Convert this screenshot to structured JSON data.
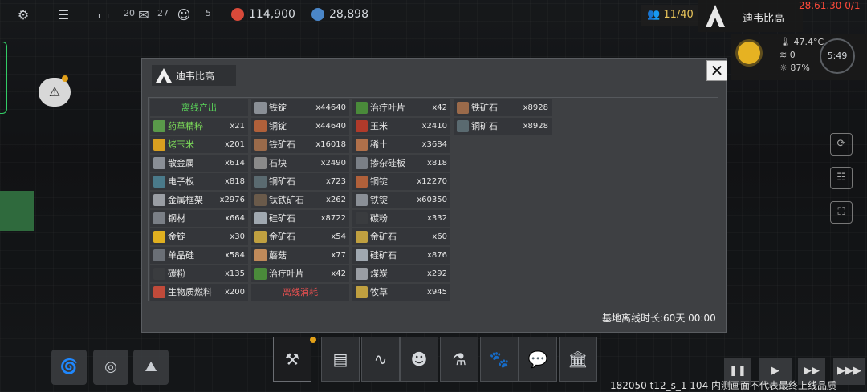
{
  "topbar": {
    "icons": [
      "gear-icon",
      "chat-icon",
      "message-icon",
      "mail-icon",
      "person-icon"
    ],
    "mail_count": "20",
    "person_count": "27",
    "small_text_left": "5",
    "resource1": {
      "value": "114,900",
      "color": "#d84a3a"
    },
    "resource2": {
      "value": "28,898",
      "color": "#4a86c8"
    }
  },
  "population": {
    "value": "11/40"
  },
  "base_name": "迪韦比高",
  "clock": "28.61.30 0/1",
  "weather": {
    "temperature": "47.4°C",
    "wind": "0",
    "light": "87%",
    "time": "5:49"
  },
  "modal": {
    "title": "迪韦比高",
    "close_label": "✕",
    "footer": "基地离线时长:60天 00:00",
    "columns": [
      [
        {
          "type": "header",
          "label": "离线产出",
          "tone": "green"
        },
        {
          "label": "药草精粹",
          "count": "x21",
          "icon": "herb-essence-icon",
          "color": "#5a9a4a",
          "highlight": true
        },
        {
          "label": "烤玉米",
          "count": "x201",
          "icon": "roasted-corn-icon",
          "color": "#d9a020",
          "highlight": true
        },
        {
          "label": "散金属",
          "count": "x614",
          "icon": "scrap-metal-icon",
          "color": "#8a8f96"
        },
        {
          "label": "电子板",
          "count": "x818",
          "icon": "circuit-board-icon",
          "color": "#4a7a8a"
        },
        {
          "label": "金属框架",
          "count": "x2976",
          "icon": "metal-frame-icon",
          "color": "#9a9ea4"
        },
        {
          "label": "钢材",
          "count": "x664",
          "icon": "steel-icon",
          "color": "#7a7f86"
        },
        {
          "label": "金锭",
          "count": "x30",
          "icon": "gold-ingot-icon",
          "color": "#e0b020"
        },
        {
          "label": "单晶硅",
          "count": "x584",
          "icon": "monocrystal-silicon-icon",
          "color": "#6a6f76"
        },
        {
          "label": "碳粉",
          "count": "x135",
          "icon": "carbon-powder-icon",
          "color": "#3a3c3f"
        },
        {
          "label": "生物质燃料",
          "count": "x200",
          "icon": "biomass-fuel-icon",
          "color": "#c04a3a"
        }
      ],
      [
        {
          "label": "铁锭",
          "count": "x44640",
          "icon": "iron-ingot-icon",
          "color": "#8a8f96"
        },
        {
          "label": "铜锭",
          "count": "x44640",
          "icon": "copper-ingot-icon",
          "color": "#b0603a"
        },
        {
          "label": "铁矿石",
          "count": "x16018",
          "icon": "iron-ore-icon",
          "color": "#9a6a4a"
        },
        {
          "label": "石块",
          "count": "x2490",
          "icon": "stone-icon",
          "color": "#8a8a8a"
        },
        {
          "label": "铜矿石",
          "count": "x723",
          "icon": "copper-ore-icon",
          "color": "#5a6a70"
        },
        {
          "label": "钛铁矿石",
          "count": "x262",
          "icon": "ilmenite-ore-icon",
          "color": "#6a5a4a"
        },
        {
          "label": "硅矿石",
          "count": "x8722",
          "icon": "silicon-ore-icon",
          "color": "#a0a8b0"
        },
        {
          "label": "金矿石",
          "count": "x54",
          "icon": "gold-ore-icon",
          "color": "#c0a040"
        },
        {
          "label": "蘑菇",
          "count": "x77",
          "icon": "mushroom-icon",
          "color": "#c08a5a"
        },
        {
          "label": "治疗叶片",
          "count": "x42",
          "icon": "healing-leaf-icon",
          "color": "#4a8a3a"
        },
        {
          "type": "header",
          "label": "离线消耗",
          "tone": "red"
        }
      ],
      [
        {
          "label": "治疗叶片",
          "count": "x42",
          "icon": "healing-leaf-icon",
          "color": "#4a8a3a"
        },
        {
          "label": "玉米",
          "count": "x2410",
          "icon": "corn-icon",
          "color": "#b03a2a"
        },
        {
          "label": "稀土",
          "count": "x3684",
          "icon": "rare-earth-icon",
          "color": "#b0704a"
        },
        {
          "label": "掺杂硅板",
          "count": "x818",
          "icon": "doped-silicon-icon",
          "color": "#7a7f86"
        },
        {
          "label": "铜锭",
          "count": "x12270",
          "icon": "copper-ingot-icon",
          "color": "#b0603a"
        },
        {
          "label": "铁锭",
          "count": "x60350",
          "icon": "iron-ingot-icon",
          "color": "#8a8f96"
        },
        {
          "label": "碳粉",
          "count": "x332",
          "icon": "carbon-powder-icon",
          "color": "#3a3c3f"
        },
        {
          "label": "金矿石",
          "count": "x60",
          "icon": "gold-ore-icon",
          "color": "#c0a040"
        },
        {
          "label": "硅矿石",
          "count": "x876",
          "icon": "silicon-ore-icon",
          "color": "#a0a8b0"
        },
        {
          "label": "煤炭",
          "count": "x292",
          "icon": "coal-icon",
          "color": "#9a9ea4"
        },
        {
          "label": "牧草",
          "count": "x945",
          "icon": "forage-grass-icon",
          "color": "#c0a040"
        }
      ],
      [
        {
          "label": "铁矿石",
          "count": "x8928",
          "icon": "iron-ore-icon",
          "color": "#9a6a4a"
        },
        {
          "label": "铜矿石",
          "count": "x8928",
          "icon": "copper-ore-icon",
          "color": "#5a6a70"
        }
      ]
    ]
  },
  "toolbar": {
    "buttons": [
      "build-hammer-icon",
      "blueprint-icon",
      "audio-wave-icon",
      "people-icon",
      "flask-icon",
      "cat-icon",
      "speech-icon",
      "bank-icon"
    ]
  },
  "speed_controls": [
    "❚❚",
    "▶",
    "▶▶",
    "▶▶▶"
  ],
  "version_text": "182050 t12_s_1 104  内测画面不代表最终上线品质"
}
